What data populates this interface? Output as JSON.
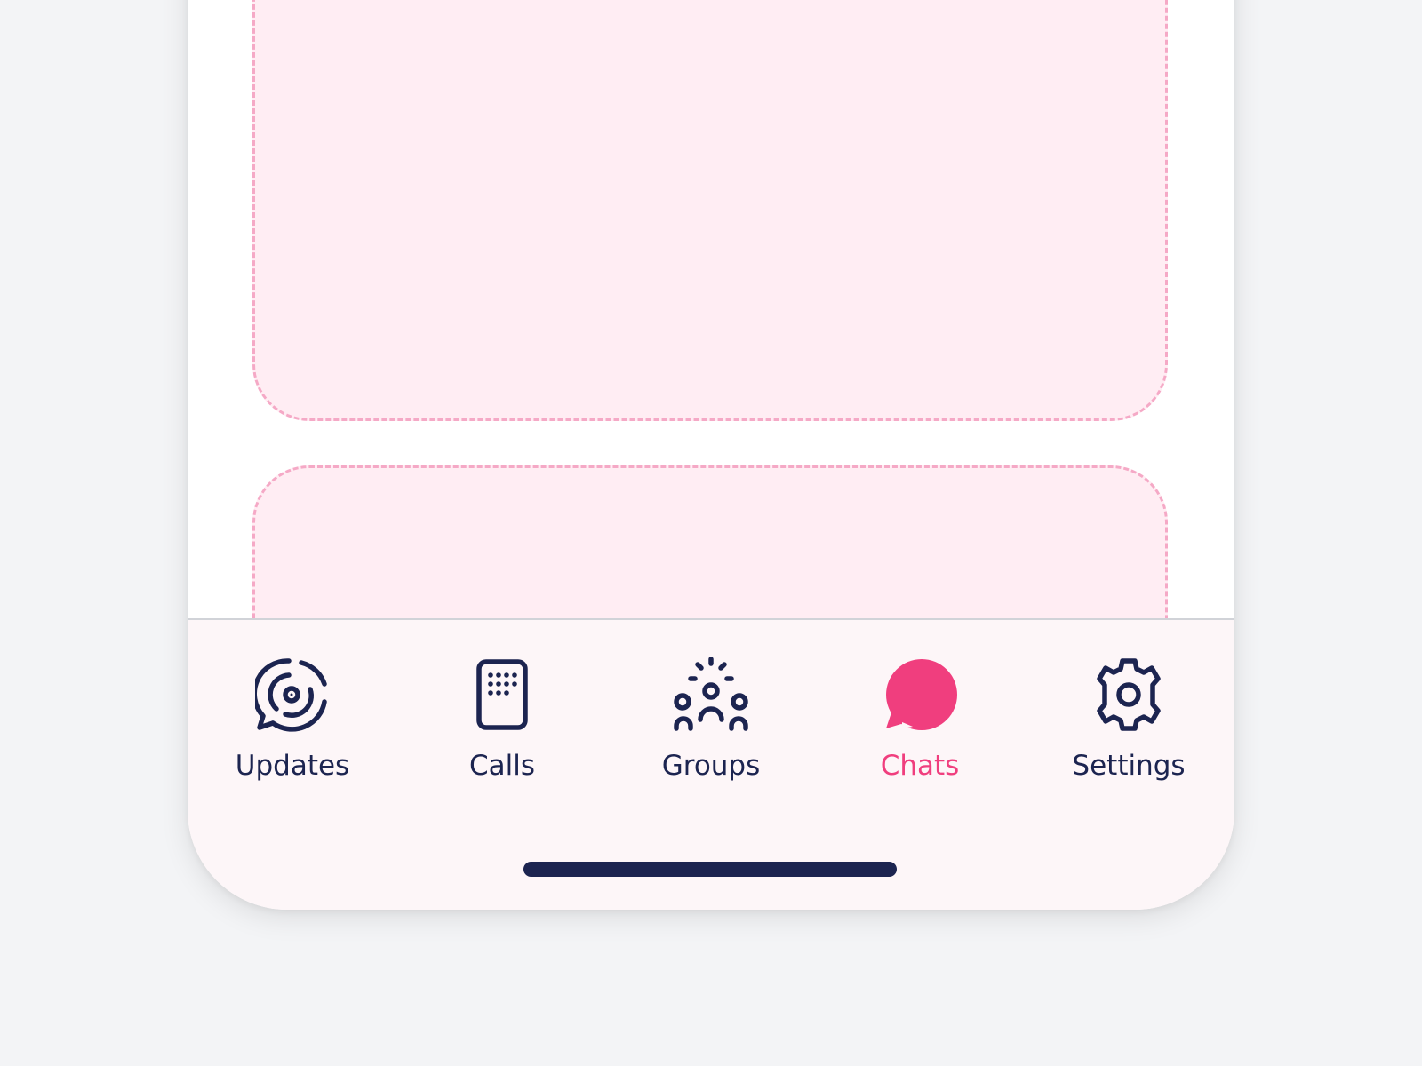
{
  "tabbar": {
    "items": [
      {
        "label": "Updates",
        "icon": "updates-icon",
        "active": false
      },
      {
        "label": "Calls",
        "icon": "phone-icon",
        "active": false
      },
      {
        "label": "Groups",
        "icon": "group-icon",
        "active": false
      },
      {
        "label": "Chats",
        "icon": "chat-bubble-icon",
        "active": true
      },
      {
        "label": "Settings",
        "icon": "gear-icon",
        "active": false
      }
    ],
    "active_color": "#f03e7e",
    "inactive_color": "#1c2450"
  },
  "colors": {
    "placeholder_fill": "#ffedf3",
    "placeholder_border": "#f5a9c6",
    "tabbar_background": "#fdf6f8",
    "page_background": "#f3f4f6"
  }
}
